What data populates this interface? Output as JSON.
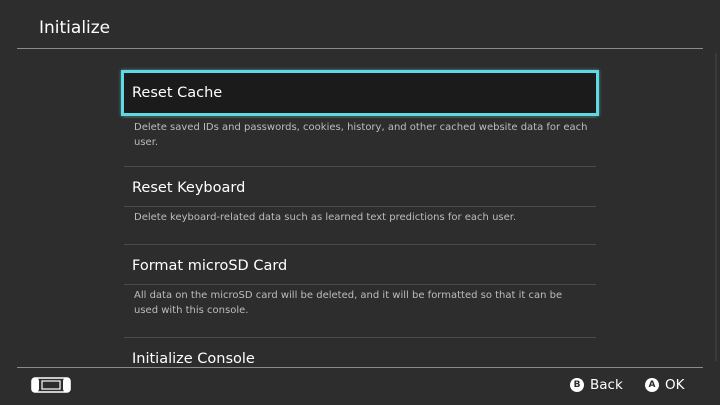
{
  "header": {
    "title": "Initialize"
  },
  "options": [
    {
      "title": "Reset Cache",
      "description": "Delete saved IDs and passwords, cookies, history, and other cached website data for each user."
    },
    {
      "title": "Reset Keyboard",
      "description": "Delete keyboard-related data such as learned text predictions for each user."
    },
    {
      "title": "Format microSD Card",
      "description": "All data on the microSD card will be deleted, and it will be formatted so that it can be used with this console."
    },
    {
      "title": "Initialize Console",
      "description": ""
    }
  ],
  "footer": {
    "controller_icon": "controller-icon",
    "back": {
      "glyph": "B",
      "label": "Back"
    },
    "ok": {
      "glyph": "A",
      "label": "OK"
    }
  },
  "colors": {
    "background": "#2d2d2d",
    "selection_border": "#5fd8e3",
    "selection_fill": "#1b1b1b",
    "description_text": "#bdbdbd"
  }
}
